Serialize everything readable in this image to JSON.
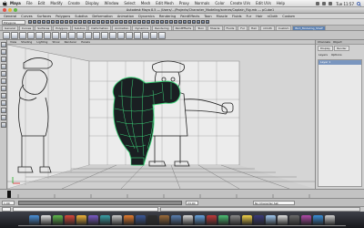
{
  "menubar": {
    "items": [
      "Maya",
      "File",
      "Edit",
      "Modify",
      "Create",
      "Display",
      "Window",
      "Select",
      "Mesh",
      "Edit Mesh",
      "Proxy",
      "Normals",
      "Color",
      "Create UVs",
      "Edit UVs",
      "Help"
    ],
    "clock": "Tue 11:57"
  },
  "window": {
    "title": "Autodesk Maya 8.5 — /Users/.../Projects/Character_Modeling/scenes/Captain_Rig.mb --- pCube1"
  },
  "maya_menus": {
    "items": [
      "General",
      "Curves",
      "Surfaces",
      "Polygons",
      "Subdivs",
      "Deformation",
      "Animation",
      "Dynamics",
      "Rendering",
      "PaintEffects",
      "Toon",
      "Muscle",
      "Fluids",
      "Fur",
      "Hair",
      "nCloth",
      "Custom"
    ]
  },
  "statusline": {
    "mode": "Polygons"
  },
  "shelf_tabs": {
    "items": [
      "General",
      "Curves",
      "Surfaces",
      "Polygons",
      "Subdivs",
      "Deformation",
      "Animation",
      "Dynamics",
      "Rendering",
      "PaintEffects",
      "Toon",
      "Muscle",
      "Fluids",
      "Fur",
      "Hair",
      "nCloth",
      "Custom",
      "Bird_Modeling_Shelf"
    ]
  },
  "panel_menu": {
    "items": [
      "View",
      "Shading",
      "Lighting",
      "Show",
      "Renderer",
      "Panels"
    ]
  },
  "channel_box": {
    "header": [
      "Channels",
      "Object"
    ],
    "tabs": [
      "Display",
      "Render"
    ],
    "radio": [
      "Layers",
      "Options"
    ],
    "rows": [
      "Layer 1"
    ]
  },
  "range": {
    "start": "1.00",
    "end": "24.00",
    "char_set": "No Character Set"
  },
  "colors": {
    "viewport_bg": "#d5d5d5",
    "selection_green": "#3dd67a",
    "dark_mesh": "#1a1f22"
  }
}
